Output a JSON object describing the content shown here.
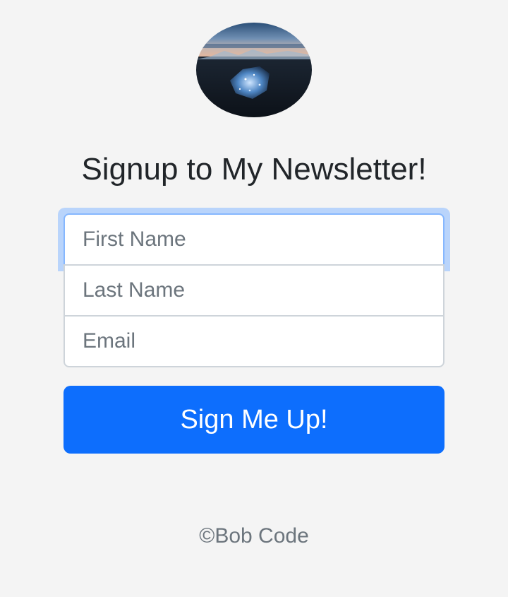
{
  "page": {
    "heading": "Signup to My Newsletter!"
  },
  "logo": {
    "icon": "landscape-photo-icon"
  },
  "form": {
    "first_name_placeholder": "First Name",
    "last_name_placeholder": "Last Name",
    "email_placeholder": "Email",
    "first_name_value": "",
    "last_name_value": "",
    "email_value": "",
    "submit_label": "Sign Me Up!"
  },
  "footer": {
    "text": "©Bob Code"
  },
  "colors": {
    "background": "#f4f4f4",
    "primary": "#0d6efd",
    "focus_ring": "#b9d4fb",
    "muted_text": "#6c757d",
    "heading_text": "#212529"
  }
}
